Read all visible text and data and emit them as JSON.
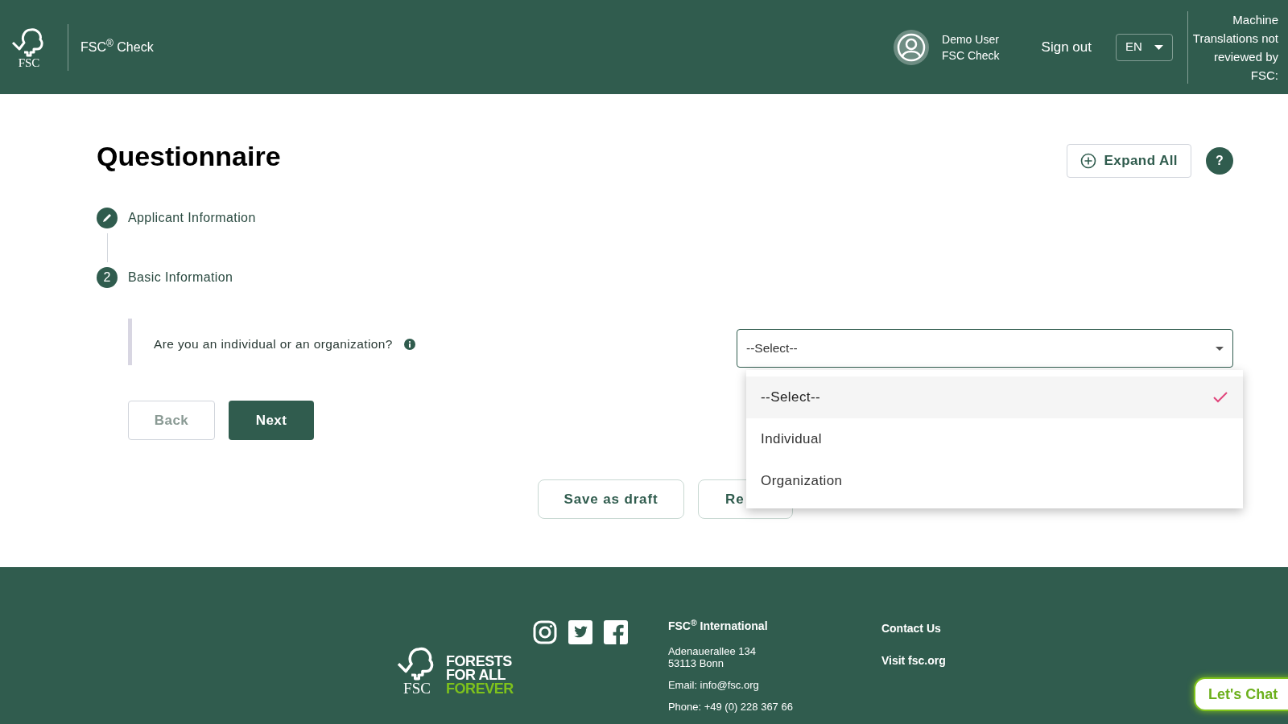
{
  "header": {
    "app_name": "FSC$^{®}$ Check",
    "logo_text": "FSC",
    "user": {
      "name": "Demo User",
      "role": "FSC Check"
    },
    "sign_out": "Sign out",
    "language": "EN",
    "notice": "Machine Translations not reviewed by FSC:"
  },
  "page": {
    "title": "Questionnaire",
    "expand_all": "Expand All",
    "help": "?"
  },
  "steps": [
    {
      "kind": "done",
      "label": "Applicant Information"
    },
    {
      "kind": "current",
      "number": "2",
      "label": "Basic Information"
    }
  ],
  "question": {
    "text": "Are you an individual or an organization?",
    "select": {
      "value": "--Select--",
      "expanded": true,
      "options": [
        {
          "label": "--Select--",
          "selected": true
        },
        {
          "label": "Individual",
          "selected": false
        },
        {
          "label": "Organization",
          "selected": false
        }
      ]
    }
  },
  "nav_buttons": [
    {
      "label": "Back",
      "disabled": true
    },
    {
      "label": "Next",
      "disabled": false
    }
  ],
  "actions": [
    "Save as draft",
    "Re"
  ],
  "footer": {
    "logo_text": "FSC",
    "slogan": [
      "FORESTS",
      "FOR ALL",
      "FOREVER"
    ],
    "address_title": "FSC$^{®}$ International",
    "address": [
      "Adenauerallee 134",
      "53113 Bonn"
    ],
    "email": "Email: info@fsc.org",
    "phone": "Phone: +49 (0) 228 367 66",
    "links": [
      "Contact Us",
      "Visit fsc.org"
    ]
  },
  "chat": "Let's Chat"
}
